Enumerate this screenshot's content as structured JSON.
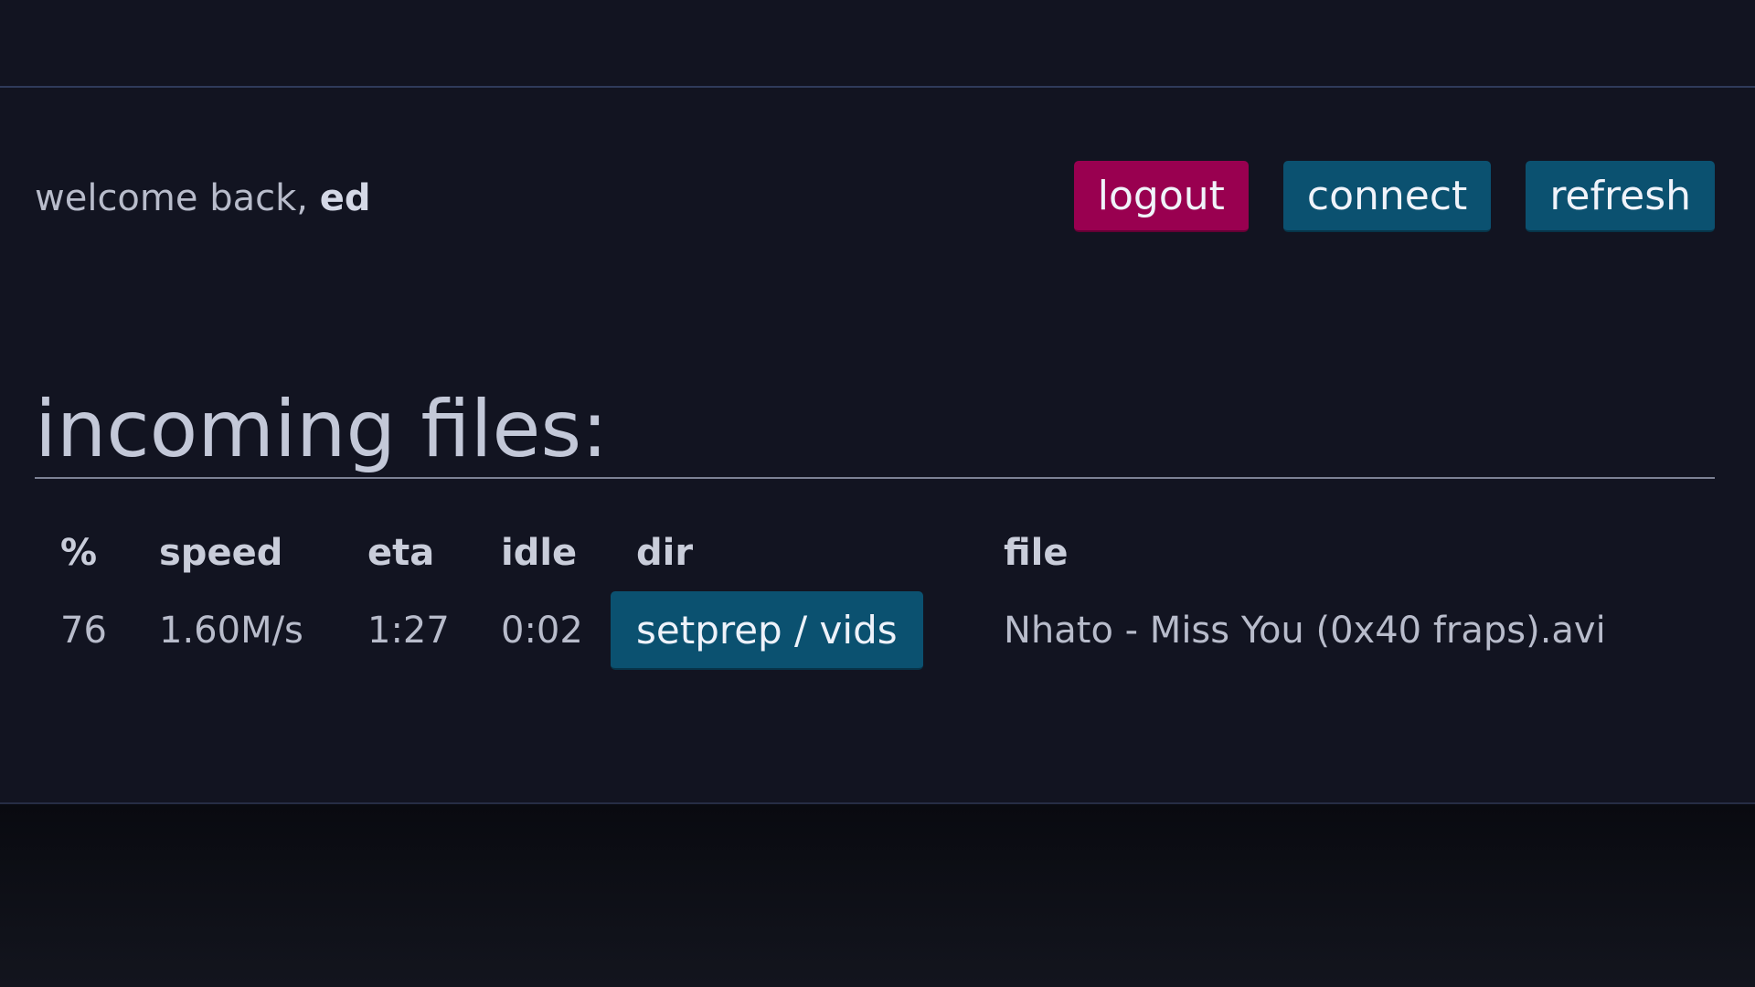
{
  "header": {
    "welcome_prefix": "welcome back, ",
    "username": "ed",
    "buttons": {
      "logout": "logout",
      "connect": "connect",
      "refresh": "refresh"
    }
  },
  "incoming": {
    "title": "incoming files:",
    "columns": {
      "percent": "%",
      "speed": "speed",
      "eta": "eta",
      "idle": "idle",
      "dir": "dir",
      "file": "file"
    },
    "rows": [
      {
        "percent": "76",
        "speed": "1.60M/s",
        "eta": "1:27",
        "idle": "0:02",
        "dir": "setprep / vids",
        "file": "Nhato - Miss You (0x40 fraps).avi"
      }
    ]
  },
  "colors": {
    "background": "#121421",
    "logout_button": "#990050",
    "primary_button": "#0b5170",
    "text": "#b8bccb"
  }
}
